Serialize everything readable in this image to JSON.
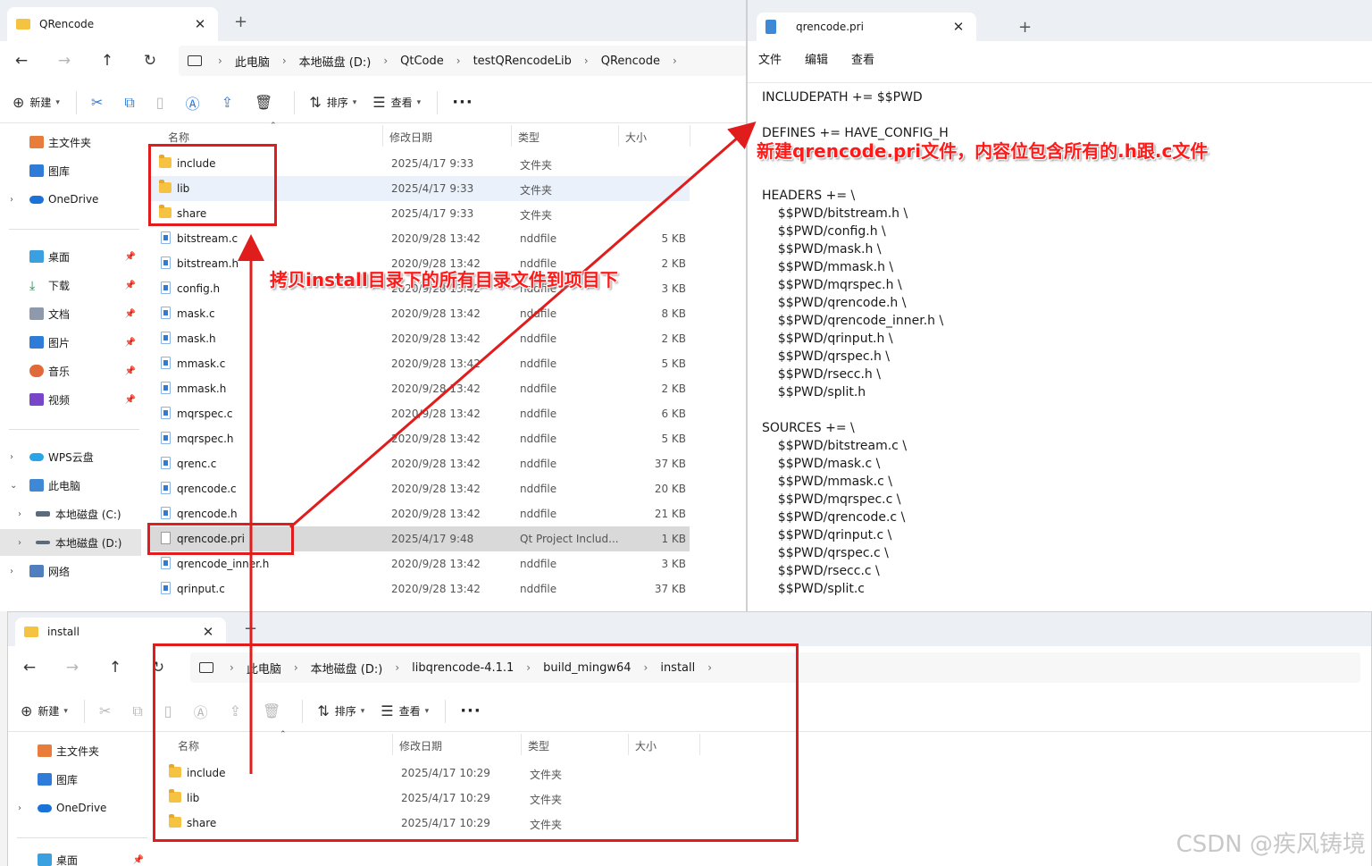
{
  "explorer_main": {
    "tab_title": "QRencode",
    "breadcrumb": [
      "此电脑",
      "本地磁盘 (D:)",
      "QtCode",
      "testQRencodeLib",
      "QRencode"
    ],
    "toolbar": {
      "new": "新建",
      "sort": "排序",
      "view": "查看"
    },
    "columns": {
      "name": "名称",
      "date": "修改日期",
      "type": "类型",
      "size": "大小"
    },
    "sidebar": {
      "home": "主文件夹",
      "gallery": "图库",
      "onedrive": "OneDrive",
      "desktop": "桌面",
      "downloads": "下载",
      "documents": "文档",
      "pictures": "图片",
      "music": "音乐",
      "videos": "视频",
      "wps": "WPS云盘",
      "thispc": "此电脑",
      "drive_c": "本地磁盘 (C:)",
      "drive_d": "本地磁盘 (D:)",
      "network": "网络"
    },
    "files": [
      {
        "name": "include",
        "date": "2025/4/17 9:33",
        "type": "文件夹",
        "size": ""
      },
      {
        "name": "lib",
        "date": "2025/4/17 9:33",
        "type": "文件夹",
        "size": ""
      },
      {
        "name": "share",
        "date": "2025/4/17 9:33",
        "type": "文件夹",
        "size": ""
      },
      {
        "name": "bitstream.c",
        "date": "2020/9/28 13:42",
        "type": "nddfile",
        "size": "5 KB"
      },
      {
        "name": "bitstream.h",
        "date": "2020/9/28 13:42",
        "type": "nddfile",
        "size": "2 KB"
      },
      {
        "name": "config.h",
        "date": "2020/9/28 13:42",
        "type": "nddfile",
        "size": "3 KB"
      },
      {
        "name": "mask.c",
        "date": "2020/9/28 13:42",
        "type": "nddfile",
        "size": "8 KB"
      },
      {
        "name": "mask.h",
        "date": "2020/9/28 13:42",
        "type": "nddfile",
        "size": "2 KB"
      },
      {
        "name": "mmask.c",
        "date": "2020/9/28 13:42",
        "type": "nddfile",
        "size": "5 KB"
      },
      {
        "name": "mmask.h",
        "date": "2020/9/28 13:42",
        "type": "nddfile",
        "size": "2 KB"
      },
      {
        "name": "mqrspec.c",
        "date": "2020/9/28 13:42",
        "type": "nddfile",
        "size": "6 KB"
      },
      {
        "name": "mqrspec.h",
        "date": "2020/9/28 13:42",
        "type": "nddfile",
        "size": "5 KB"
      },
      {
        "name": "qrenc.c",
        "date": "2020/9/28 13:42",
        "type": "nddfile",
        "size": "37 KB"
      },
      {
        "name": "qrencode.c",
        "date": "2020/9/28 13:42",
        "type": "nddfile",
        "size": "20 KB"
      },
      {
        "name": "qrencode.h",
        "date": "2020/9/28 13:42",
        "type": "nddfile",
        "size": "21 KB"
      },
      {
        "name": "qrencode.pri",
        "date": "2025/4/17 9:48",
        "type": "Qt Project Includ...",
        "size": "1 KB"
      },
      {
        "name": "qrencode_inner.h",
        "date": "2020/9/28 13:42",
        "type": "nddfile",
        "size": "3 KB"
      },
      {
        "name": "qrinput.c",
        "date": "2020/9/28 13:42",
        "type": "nddfile",
        "size": "37 KB"
      }
    ]
  },
  "notepad": {
    "tab_title": "qrencode.pri",
    "menu": [
      "文件",
      "编辑",
      "查看"
    ],
    "lines": [
      "INCLUDEPATH += $$PWD",
      "",
      "DEFINES += HAVE_CONFIG_H",
      "",
      "",
      "HEADERS += \\",
      "    $$PWD/bitstream.h \\",
      "    $$PWD/config.h \\",
      "    $$PWD/mask.h \\",
      "    $$PWD/mmask.h \\",
      "    $$PWD/mqrspec.h \\",
      "    $$PWD/qrencode.h \\",
      "    $$PWD/qrencode_inner.h \\",
      "    $$PWD/qrinput.h \\",
      "    $$PWD/qrspec.h \\",
      "    $$PWD/rsecc.h \\",
      "    $$PWD/split.h",
      "",
      "SOURCES += \\",
      "    $$PWD/bitstream.c \\",
      "    $$PWD/mask.c \\",
      "    $$PWD/mmask.c \\",
      "    $$PWD/mqrspec.c \\",
      "    $$PWD/qrencode.c \\",
      "    $$PWD/qrinput.c \\",
      "    $$PWD/qrspec.c \\",
      "    $$PWD/rsecc.c \\",
      "    $$PWD/split.c"
    ]
  },
  "explorer_install": {
    "tab_title": "install",
    "breadcrumb": [
      "此电脑",
      "本地磁盘 (D:)",
      "libqrencode-4.1.1",
      "build_mingw64",
      "install"
    ],
    "toolbar": {
      "new": "新建",
      "sort": "排序",
      "view": "查看"
    },
    "columns": {
      "name": "名称",
      "date": "修改日期",
      "type": "类型",
      "size": "大小"
    },
    "sidebar": {
      "home": "主文件夹",
      "gallery": "图库",
      "onedrive": "OneDrive",
      "desktop": "桌面"
    },
    "files": [
      {
        "name": "include",
        "date": "2025/4/17 10:29",
        "type": "文件夹"
      },
      {
        "name": "lib",
        "date": "2025/4/17 10:29",
        "type": "文件夹"
      },
      {
        "name": "share",
        "date": "2025/4/17 10:29",
        "type": "文件夹"
      }
    ]
  },
  "annotations": {
    "copy_note": "拷贝install目录下的所有目录文件到项目下",
    "pri_note": "新建qrencode.pri文件，内容位包含所有的.h跟.c文件",
    "accent": "#e01c1c"
  },
  "watermark": "CSDN @疾风铸境"
}
